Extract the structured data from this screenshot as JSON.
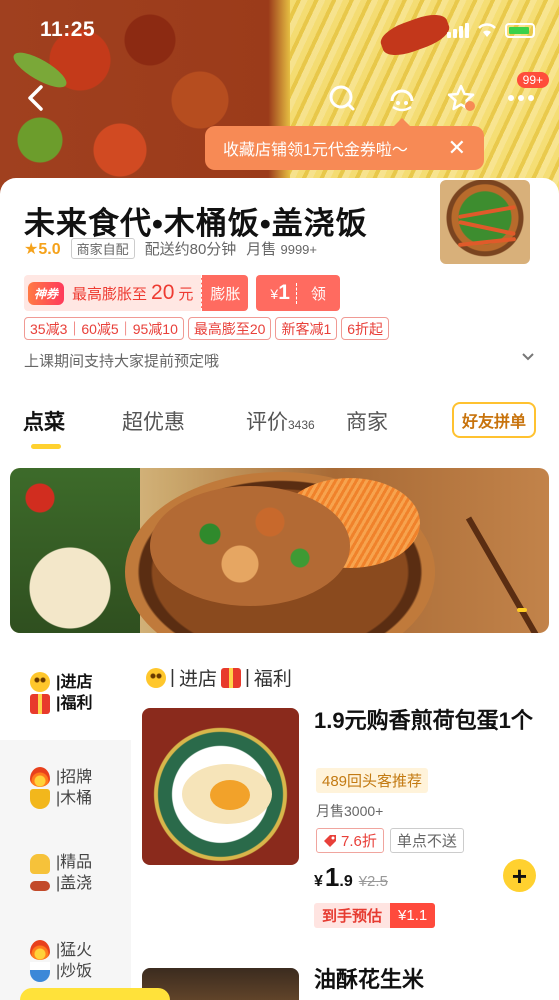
{
  "status_bar": {
    "time": "11:25"
  },
  "topbar": {
    "notification_badge": "99+"
  },
  "coupon_tip": {
    "text": "收藏店铺领1元代金券啦～"
  },
  "shop": {
    "name": "未来食代•木桶饭•盖浇饭",
    "rating": "★5.0",
    "delivery_type": "商家自配",
    "delivery_time": "配送约80分钟",
    "monthly_sales_label": "月售",
    "monthly_sales": "9999+",
    "notice": "上课期间支持大家提前预定哦"
  },
  "promo": {
    "shen_tag": "神券",
    "inflate_prefix": "最高膨胀至",
    "inflate_amount": "20",
    "inflate_unit": "元",
    "inflate_button": "膨胀",
    "coupon_currency": "¥",
    "coupon_amount": "1",
    "claim_button": "领"
  },
  "discount_tags": [
    "35减3｜60减5｜95减10",
    "最高膨至20",
    "新客减1",
    "6折起"
  ],
  "tabs": [
    {
      "label": "点菜"
    },
    {
      "label": "超优惠"
    },
    {
      "label": "评价",
      "count": "3436"
    },
    {
      "label": "商家"
    }
  ],
  "friend_button": "好友拼单",
  "sidebar": {
    "items": [
      {
        "line1": "进店",
        "line2": "福利"
      },
      {
        "line1": "招牌",
        "line2": "木桶"
      },
      {
        "line1": "精品",
        "line2": "盖浇"
      },
      {
        "line1": "猛火",
        "line2": "炒饭"
      }
    ]
  },
  "section": {
    "part1": "进店",
    "part2": "福利"
  },
  "products": [
    {
      "title": "1.9元购香煎荷包蛋1个",
      "rec": "489回头客推荐",
      "sales": "月售3000+",
      "discount": "7.6折",
      "single_order": "单点不送",
      "currency": "¥",
      "price_int": "1",
      "price_dec": ".9",
      "orig_price": "¥2.5",
      "est_label": "到手预估",
      "est_value": "¥1.1"
    },
    {
      "title": "油酥花生米"
    }
  ],
  "colors": {
    "accent": "#ffd12f",
    "promo_red": "#ff4a3c",
    "tip_orange": "#f78a55"
  }
}
